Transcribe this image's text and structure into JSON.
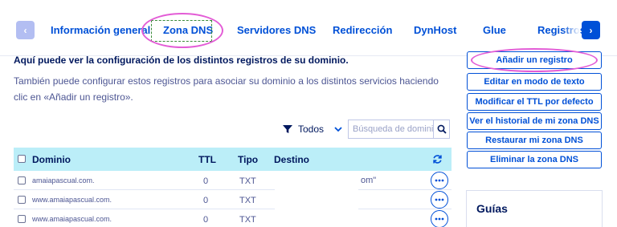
{
  "tabs": {
    "items": [
      "Información general",
      "Zona DNS",
      "Servidores DNS",
      "Redirección",
      "DynHost",
      "Glue",
      "Registros D"
    ],
    "active": "Zona DNS"
  },
  "intro": {
    "title": "Aquí puede ver la configuración de los distintos registros de su dominio.",
    "text": "También puede configurar estos registros para asociar su dominio a los distintos servicios haciendo clic en «Añadir un registro»."
  },
  "filter": {
    "select_value": "Todos",
    "search_placeholder": "Búsqueda de dominio..."
  },
  "table": {
    "headers": {
      "dominio": "Dominio",
      "ttl": "TTL",
      "tipo": "Tipo",
      "destino": "Destino"
    },
    "rows": [
      {
        "dominio": "amaiapascual.com.",
        "ttl": "0",
        "tipo": "TXT",
        "destino": "om\""
      },
      {
        "dominio": "www.amaiapascual.com.",
        "ttl": "0",
        "tipo": "TXT",
        "destino": ""
      },
      {
        "dominio": "www.amaiapascual.com.",
        "ttl": "0",
        "tipo": "TXT",
        "destino": ""
      }
    ]
  },
  "actions": [
    "Añadir un registro",
    "Editar en modo de texto",
    "Modificar el TTL por defecto",
    "Ver el historial de mi zona DNS",
    "Restaurar mi zona DNS",
    "Eliminar la zona DNS"
  ],
  "guides": {
    "title": "Guías"
  },
  "colors": {
    "accent": "#0050d7",
    "header_bg": "#bbeef8",
    "annotation": "#e35cd6",
    "text_dark": "#00185e"
  }
}
